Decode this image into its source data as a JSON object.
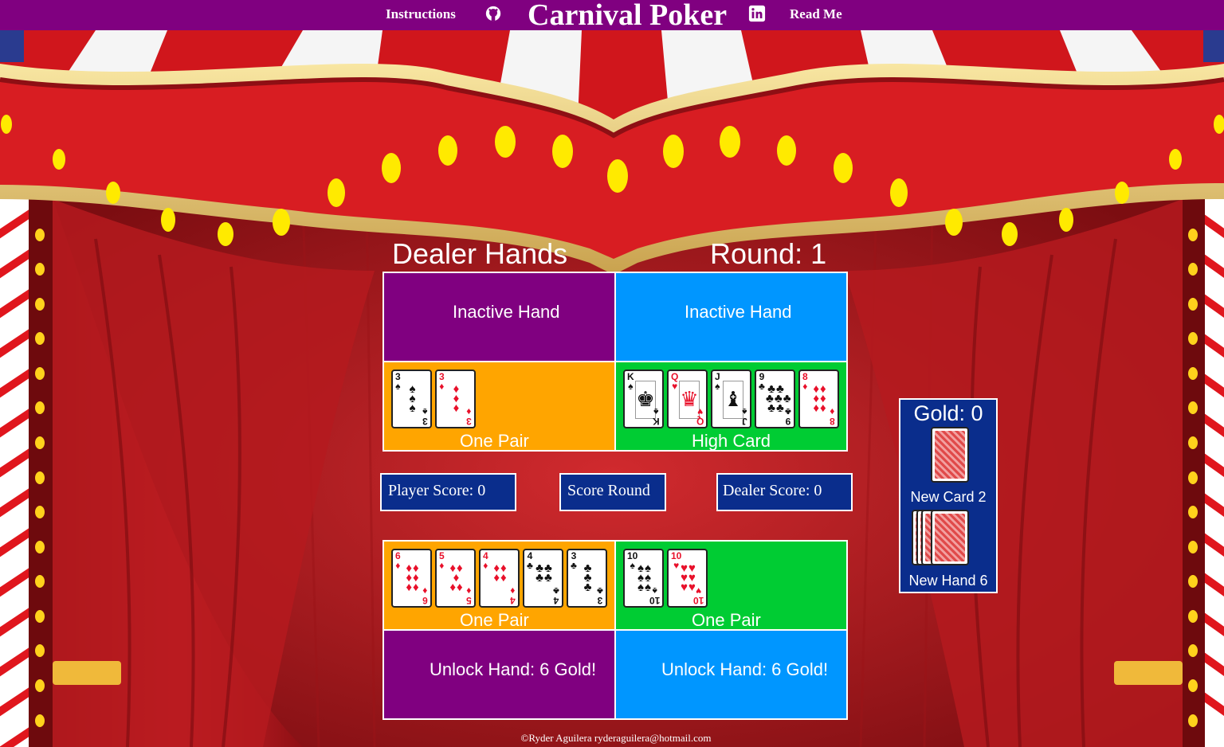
{
  "nav": {
    "instructions": "Instructions",
    "title": "Carnival Poker",
    "readme": "Read Me",
    "icons": [
      "github-icon",
      "linkedin-icon"
    ]
  },
  "headings": {
    "dealer_hands": "Dealer Hands",
    "round": "Round: 1"
  },
  "dealer": {
    "hand_1_status": "Inactive Hand",
    "hand_2_status": "Inactive Hand",
    "hand_1_result": "One Pair",
    "hand_2_result": "High Card",
    "hand_1_cards": [
      {
        "rank": "3",
        "suit": "♠",
        "color": "black",
        "pips": "♠ ♠ ♠"
      },
      {
        "rank": "3",
        "suit": "♦",
        "color": "red",
        "pips": "♦ ♦ ♦"
      }
    ],
    "hand_2_cards": [
      {
        "rank": "K",
        "suit": "♠",
        "color": "black",
        "face": "♚"
      },
      {
        "rank": "Q",
        "suit": "♥",
        "color": "red",
        "face": "♛"
      },
      {
        "rank": "J",
        "suit": "♠",
        "color": "black",
        "face": "♝"
      },
      {
        "rank": "9",
        "suit": "♣",
        "color": "black",
        "pips": "♣♣ ♣♣♣ ♣♣"
      },
      {
        "rank": "8",
        "suit": "♦",
        "color": "red",
        "pips": "♦♦ ♦♦ ♦♦"
      }
    ]
  },
  "scores": {
    "player": "Player Score: 0",
    "score_round": "Score Round",
    "dealer": "Dealer Score: 0"
  },
  "player": {
    "hand_1_result": "One Pair",
    "hand_2_result": "One Pair",
    "hand_1_cards": [
      {
        "rank": "6",
        "suit": "♦",
        "color": "red",
        "pips": "♦♦ ♦♦ ♦♦"
      },
      {
        "rank": "5",
        "suit": "♦",
        "color": "red",
        "pips": "♦♦ ♦ ♦♦"
      },
      {
        "rank": "4",
        "suit": "♦",
        "color": "red",
        "pips": "♦♦ ♦♦"
      },
      {
        "rank": "4",
        "suit": "♣",
        "color": "black",
        "pips": "♣♣ ♣♣"
      },
      {
        "rank": "3",
        "suit": "♣",
        "color": "black",
        "pips": "♣ ♣ ♣"
      }
    ],
    "hand_2_cards": [
      {
        "rank": "10",
        "suit": "♠",
        "color": "black",
        "pips": "♠♠ ♠♠ ♠♠"
      },
      {
        "rank": "10",
        "suit": "♥",
        "color": "red",
        "pips": "♥♥ ♥♥ ♥♥"
      }
    ],
    "hand_3_status": "Unlock Hand: 6 Gold!",
    "hand_4_status": "Unlock Hand: 6 Gold!"
  },
  "side": {
    "gold": "Gold: 0",
    "new_card": "New Card 2",
    "new_hand": "New Hand 6"
  },
  "footer": "©Ryder Aguilera ryderaguilera@hotmail.com",
  "colors": {
    "nav": "#800080",
    "purple_cell": "#800080",
    "blue_cell": "#0096ff",
    "orange_cell": "#ffa500",
    "green_cell": "#00cc33",
    "score_box": "#0a2d8c"
  }
}
